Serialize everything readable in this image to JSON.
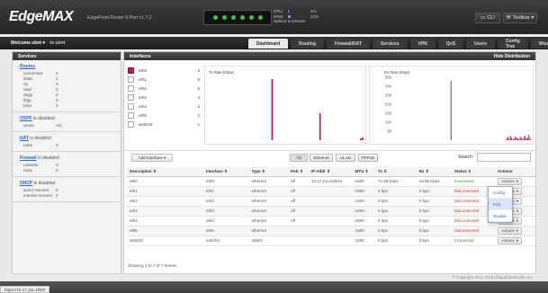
{
  "app": {
    "logo": "EdgeMAX",
    "subtitle": "EdgePoint Router 6 Port v1.7.2"
  },
  "status_lights": [
    true,
    true,
    true,
    true,
    true,
    true
  ],
  "sysinfo": {
    "cpu_label": "CPU:",
    "cpu_value": "1%",
    "cpu_fraction": 0.01,
    "ram_label": "RAM:",
    "ram_value": "12%",
    "ram_fraction": 0.12,
    "uptime_label": "Uptime:",
    "uptime_value": "5 minutes"
  },
  "topbar": {
    "cli_label": "CLI",
    "toolbox_label": "Toolbox"
  },
  "nav": {
    "welcome": "Welcome ubnt",
    "logout": "to ubnt",
    "tabs": [
      "Dashboard",
      "Routing",
      "Firewall/NAT",
      "Services",
      "VPN",
      "QoS",
      "Users",
      "Config Tree",
      "Wizards"
    ],
    "active_tab": "Dashboard"
  },
  "sidebar": {
    "header": "Services",
    "routes": {
      "title": "Routes",
      "rows": [
        {
          "k": "connected",
          "v": "2"
        },
        {
          "k": "static",
          "v": "1"
        },
        {
          "k": "rip",
          "v": "0"
        },
        {
          "k": "ospf",
          "v": "0"
        },
        {
          "k": "ebgp",
          "v": "0"
        },
        {
          "k": "ibgp",
          "v": "0"
        },
        {
          "k": "total",
          "v": "3"
        }
      ]
    },
    "ospf": {
      "title": "OSPF",
      "suffix": "is disabled",
      "rows": [
        {
          "k": "areas",
          "v": "n/a"
        }
      ]
    },
    "nat": {
      "title": "NAT",
      "suffix": "is disabled",
      "rows": [
        {
          "k": "rules",
          "v": "0"
        }
      ]
    },
    "firewall": {
      "title": "Firewall",
      "suffix": "is disabled",
      "rows": [
        {
          "k": "rulesets",
          "v": "0"
        },
        {
          "k": "rules",
          "v": "0"
        }
      ]
    },
    "dhcp": {
      "title": "DHCP",
      "suffix": "is disabled",
      "rows": [
        {
          "k": "active servers",
          "v": "0"
        },
        {
          "k": "inactive servers",
          "v": "0"
        }
      ]
    }
  },
  "interfaces_panel": {
    "header": "Interfaces",
    "hide_distribution": "Hide Distribution",
    "list": [
      {
        "name": "eth0",
        "count": "3",
        "checked": true
      },
      {
        "name": "eth1",
        "count": "6",
        "checked": false
      },
      {
        "name": "eth2",
        "count": "5",
        "checked": false
      },
      {
        "name": "eth3",
        "count": "4",
        "checked": false
      },
      {
        "name": "eth4",
        "count": "2",
        "checked": false
      },
      {
        "name": "eth5",
        "count": "2",
        "checked": false
      },
      {
        "name": "switch0",
        "count": "1",
        "checked": false
      }
    ]
  },
  "chart_data": [
    {
      "type": "bar",
      "title": "Tx Rate (Kbps)",
      "ylim": [
        0,
        350
      ],
      "color": "#c01a4a",
      "values": [
        0,
        0,
        0,
        0,
        0,
        0,
        0,
        0,
        0,
        0,
        0,
        0,
        0,
        0,
        0,
        0,
        0,
        0,
        0,
        0,
        0,
        0,
        0,
        0,
        0,
        0,
        0,
        0,
        0,
        0,
        0,
        0,
        0,
        0,
        340,
        0,
        0,
        0,
        0,
        0,
        0,
        0,
        0,
        0,
        0,
        0,
        0,
        0,
        0,
        0,
        0,
        0,
        0,
        0,
        0,
        0,
        0,
        0,
        0,
        0,
        150,
        0,
        0,
        0,
        0,
        0,
        0,
        0,
        0,
        0,
        0,
        0,
        0,
        0,
        0,
        0,
        0,
        0,
        0,
        0,
        0,
        0,
        10,
        15
      ]
    },
    {
      "type": "bar",
      "title": "Rx Rate (Kbps)",
      "ylim": [
        0,
        350
      ],
      "yticks": [
        "350",
        "300",
        "250",
        "200",
        "150",
        "100",
        "50"
      ],
      "color": "#c01a4a",
      "values": [
        0,
        0,
        0,
        0,
        0,
        0,
        0,
        0,
        0,
        0,
        0,
        0,
        0,
        0,
        0,
        0,
        0,
        0,
        0,
        0,
        0,
        0,
        0,
        0,
        0,
        0,
        0,
        0,
        0,
        0,
        0,
        0,
        0,
        0,
        0,
        0,
        0,
        0,
        0,
        0,
        0,
        0,
        0,
        0,
        0,
        330,
        0,
        0,
        0,
        0,
        0,
        0,
        0,
        0,
        0,
        0,
        0,
        0,
        0,
        0,
        0,
        0,
        0,
        0,
        0,
        0,
        0,
        0,
        0,
        0,
        0,
        0,
        0,
        0,
        0,
        0,
        0,
        0,
        0,
        0,
        0,
        0,
        0,
        0,
        0,
        0,
        0,
        0,
        0,
        0,
        12,
        18,
        8,
        25,
        14,
        6,
        9,
        22,
        16,
        11,
        5,
        20,
        13,
        7,
        18,
        24,
        10,
        15,
        30,
        12
      ]
    }
  ],
  "toolbar": {
    "add_interface": "Add Interface",
    "filters": [
      "All",
      "Ethernet",
      "VLAN",
      "PPPoE"
    ],
    "active_filter": "All",
    "search_label": "Search:",
    "search_placeholder": ""
  },
  "table": {
    "headers": [
      "Description",
      "Interface",
      "Type",
      "PoE",
      "IP Addr",
      "MTU",
      "Tx",
      "Rx",
      "Status",
      "Actions"
    ],
    "rows": [
      {
        "desc": "eth0",
        "iface": "eth0",
        "type": "ethernet",
        "poe": "off",
        "ip": "10.17.111.105/24",
        "mtu": "1500",
        "tx": "72.25 Kbps",
        "rx": "14.85 Kbps",
        "status": "Connected",
        "connected": true
      },
      {
        "desc": "eth1",
        "iface": "eth1",
        "type": "ethernet",
        "poe": "off",
        "ip": "",
        "mtu": "1500",
        "tx": "0 bps",
        "rx": "0 bps",
        "status": "Disconnected",
        "connected": false
      },
      {
        "desc": "eth2",
        "iface": "eth2",
        "type": "ethernet",
        "poe": "off",
        "ip": "",
        "mtu": "1500",
        "tx": "0 bps",
        "rx": "0 bps",
        "status": "Disconnected",
        "connected": false
      },
      {
        "desc": "eth3",
        "iface": "eth3",
        "type": "ethernet",
        "poe": "off",
        "ip": "",
        "mtu": "1500",
        "tx": "0 bps",
        "rx": "0 bps",
        "status": "Disconnected",
        "connected": false
      },
      {
        "desc": "eth4",
        "iface": "eth4",
        "type": "ethernet",
        "poe": "off",
        "ip": "",
        "mtu": "1500",
        "tx": "0 bps",
        "rx": "0 bps",
        "status": "Disconnected",
        "connected": false
      },
      {
        "desc": "eth5",
        "iface": "eth5",
        "type": "ethernet",
        "poe": "",
        "ip": "",
        "mtu": "1500",
        "tx": "0 bps",
        "rx": "0 bps",
        "status": "Disconnected",
        "connected": false
      },
      {
        "desc": "switch0",
        "iface": "switch0",
        "type": "switch",
        "poe": "",
        "ip": "",
        "mtu": "1500",
        "tx": "0 bps",
        "rx": "0 bps",
        "status": "Connected",
        "connected": true
      }
    ],
    "action_label": "Actions",
    "showing": "Showing 1 to 7 of 7 entries"
  },
  "dropdown": {
    "items": [
      "Config",
      "PoE",
      "Disable"
    ],
    "highlighted": "PoE"
  },
  "footer": {
    "copyright": "© Copyright 2012-2015 Ubiquiti Networks, Inc."
  },
  "url": "https://10.17.111.105/#"
}
